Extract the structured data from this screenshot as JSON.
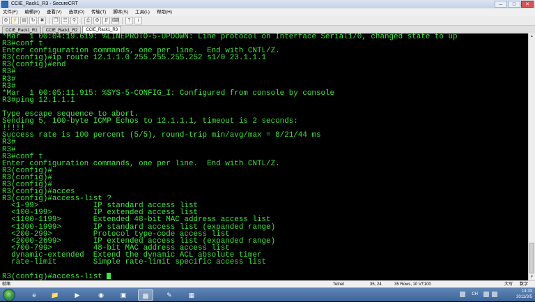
{
  "window": {
    "title": "CCIE_Rack1_R3 - SecureCRT"
  },
  "menu": [
    "文件(F)",
    "编辑(E)",
    "查看(V)",
    "选项(O)",
    "传输(T)",
    "脚本(S)",
    "工具(L)",
    "帮助(H)"
  ],
  "tabs": [
    {
      "label": "CCIE_Rack1_R1",
      "active": false
    },
    {
      "label": "CCIE_Rack1_R2",
      "active": false
    },
    {
      "label": "CCIE_Rack1_R3",
      "active": true
    }
  ],
  "terminal": {
    "lines": [
      "*Mar  1 00:04:19.619: %LINEPROTO-5-UPDOWN: Line protocol on Interface Serial1/0, changed state to up",
      "R3#conf t",
      "Enter configuration commands, one per line.  End with CNTL/Z.",
      "R3(config)#ip route 12.1.1.0 255.255.255.252 s1/0 23.1.1.1",
      "R3(config)#end",
      "R3#",
      "R3#",
      "R3#",
      "*Mar  1 00:05:11.915: %SYS-5-CONFIG_I: Configured from console by console",
      "R3#ping 12.1.1.1",
      "",
      "Type escape sequence to abort.",
      "Sending 5, 100-byte ICMP Echos to 12.1.1.1, timeout is 2 seconds:",
      "!!!!!",
      "Success rate is 100 percent (5/5), round-trip min/avg/max = 8/21/44 ms",
      "R3#",
      "R3#",
      "R3#conf t",
      "Enter configuration commands, one per line.  End with CNTL/Z.",
      "R3(config)#",
      "R3(config)#",
      "R3(config)#",
      "R3(config)#acces",
      "R3(config)#access-list ?",
      "  <1-99>            IP standard access list",
      "  <100-199>         IP extended access list",
      "  <1100-1199>       Extended 48-bit MAC address access list",
      "  <1300-1999>       IP standard access list (expanded range)",
      "  <200-299>         Protocol type-code access list",
      "  <2000-2699>       IP extended access list (expanded range)",
      "  <700-799>         48-bit MAC address access list",
      "  dynamic-extended  Extend the dynamic ACL absolute timer",
      "  rate-limit        Simple rate-limit specific access list",
      "",
      "R3(config)#access-list "
    ]
  },
  "status": {
    "left": "就绪",
    "protocol": "Telnet",
    "cursor_pos": "35,  24",
    "size": "35 Rows, 10 VT100",
    "caps": "大写",
    "num": "数字"
  },
  "taskbar": {
    "lang": "CH",
    "time": "14:33",
    "date": "2011/3/5"
  },
  "colors": {
    "terminal_fg": "#3ce63c",
    "terminal_bg": "#000000"
  }
}
